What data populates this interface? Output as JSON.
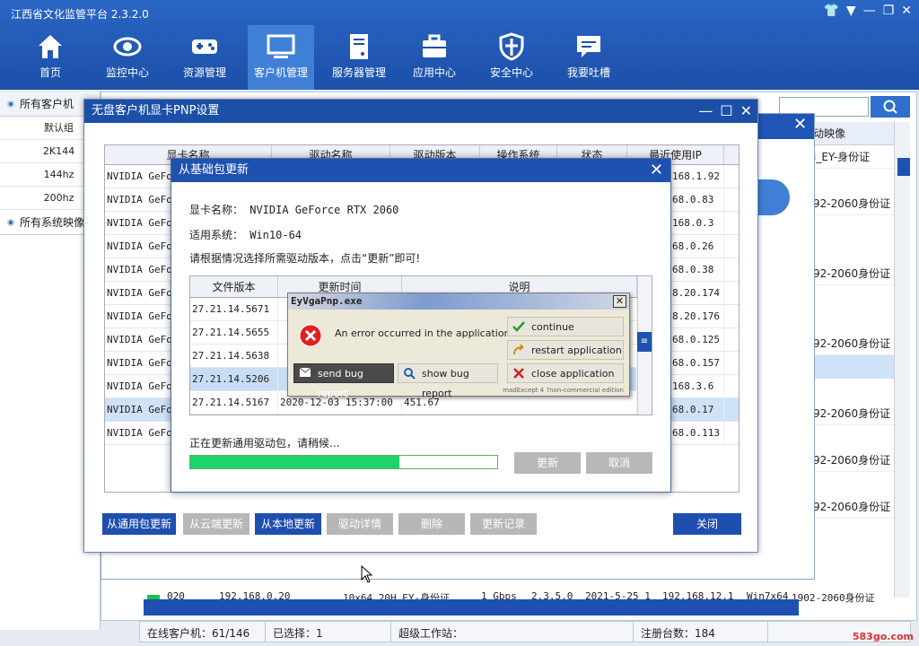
{
  "app": {
    "title": "江西省文化监管平台 2.3.2.0",
    "window_controls": [
      "👕",
      "▼",
      "—",
      "❐",
      "✕"
    ]
  },
  "nav": [
    {
      "label": "首页",
      "icon": "home-icon"
    },
    {
      "label": "监控中心",
      "icon": "eye-icon"
    },
    {
      "label": "资源管理",
      "icon": "gamepad-icon"
    },
    {
      "label": "客户机管理",
      "icon": "monitor-icon",
      "active": true
    },
    {
      "label": "服务器管理",
      "icon": "server-icon"
    },
    {
      "label": "应用中心",
      "icon": "briefcase-icon"
    },
    {
      "label": "安全中心",
      "icon": "shield-icon"
    },
    {
      "label": "我要吐槽",
      "icon": "chat-icon"
    }
  ],
  "left": {
    "all_clients": "所有客户机",
    "groups": [
      "默认组",
      "2K144",
      "144hz",
      "200hz"
    ],
    "all_images": "所有系统映像"
  },
  "bg": {
    "right_header": "动映像",
    "right_cells": [
      "i_EY-身份证",
      "92-2060身份证",
      "92-2060身份证",
      "92-2060身份证",
      "92-2060身份证",
      "92-2060身份证",
      "92-2060身份证",
      "92-2060身份证"
    ],
    "bottom_row": [
      "020",
      "192.168.0.20",
      "10x64_20H_EY-身份证",
      "1 Gbps",
      "2.3.5.0",
      "2021-5-25 1",
      "192.168.12.1",
      "Win7x64",
      "1902-2060身份证"
    ],
    "status": {
      "online": "在线客户机：61/146",
      "selected": "已选择：1",
      "super": "超级工作站：",
      "registered": "注册台数：184"
    },
    "watermark": "583go.com"
  },
  "pnp": {
    "title": "无盘客户机显卡PNP设置",
    "headers": [
      "显卡名称",
      "驱动名称",
      "驱动版本",
      "操作系统",
      "状态",
      "最近使用IP"
    ],
    "rows": [
      {
        "name": "NVIDIA GeFor",
        "ip": "168.1.92"
      },
      {
        "name": "NVIDIA GeFor",
        "ip": "68.0.83"
      },
      {
        "name": "NVIDIA GeFor",
        "ip": "168.0.3"
      },
      {
        "name": "NVIDIA GeFor",
        "ip": "68.0.26"
      },
      {
        "name": "NVIDIA GeFor",
        "ip": "68.0.38"
      },
      {
        "name": "NVIDIA GeFor",
        "ip": "8.20.174"
      },
      {
        "name": "NVIDIA GeFor",
        "ip": "8.20.176"
      },
      {
        "name": "NVIDIA GeFor",
        "ip": "68.0.125"
      },
      {
        "name": "NVIDIA GeFor",
        "ip": "68.0.157"
      },
      {
        "name": "NVIDIA GeFor",
        "ip": "168.3.6"
      },
      {
        "name": "NVIDIA GeFor",
        "ip": "68.0.17"
      },
      {
        "name": "NVIDIA GeFor",
        "ip": "68.0.113"
      }
    ],
    "buttons": {
      "from_common": "从通用包更新",
      "from_cloud": "从云端更新",
      "from_local": "从本地更新",
      "driver_detail": "驱动详情",
      "delete": "删除",
      "update_log": "更新记录",
      "close": "关闭"
    }
  },
  "update": {
    "title": "从基础包更新",
    "gpu_line": "显卡名称：  NVIDIA GeForce RTX 2060",
    "os_line": "适用系统：  Win10-64",
    "hint": "请根据情况选择所需驱动版本，点击“更新”即可!",
    "headers": [
      "文件版本",
      "更新时间",
      "说明"
    ],
    "rows": [
      {
        "ver": "27.21.14.5671",
        "time": "",
        "desc": ""
      },
      {
        "ver": "27.21.14.5655",
        "time": "",
        "desc": ""
      },
      {
        "ver": "27.21.14.5638",
        "time": "",
        "desc": ""
      },
      {
        "ver": "27.21.14.5206",
        "time": "",
        "desc": ""
      },
      {
        "ver": "27.21.14.5167",
        "time": "2020-12-03 15:37:00",
        "desc": "451.67"
      }
    ],
    "progress_text": "正在更新通用驱动包，请稍候...",
    "progress": 0.68,
    "btn_update": "更新",
    "btn_cancel": "取消"
  },
  "mad": {
    "title": "EyVgaPnp.exe",
    "message": "An error occurred in the application.",
    "continue": "continue application",
    "restart": "restart application",
    "close": "close application",
    "send": "send bug report",
    "show": "show bug report",
    "footer": "madExcept 4 ?non-commercial edition"
  }
}
